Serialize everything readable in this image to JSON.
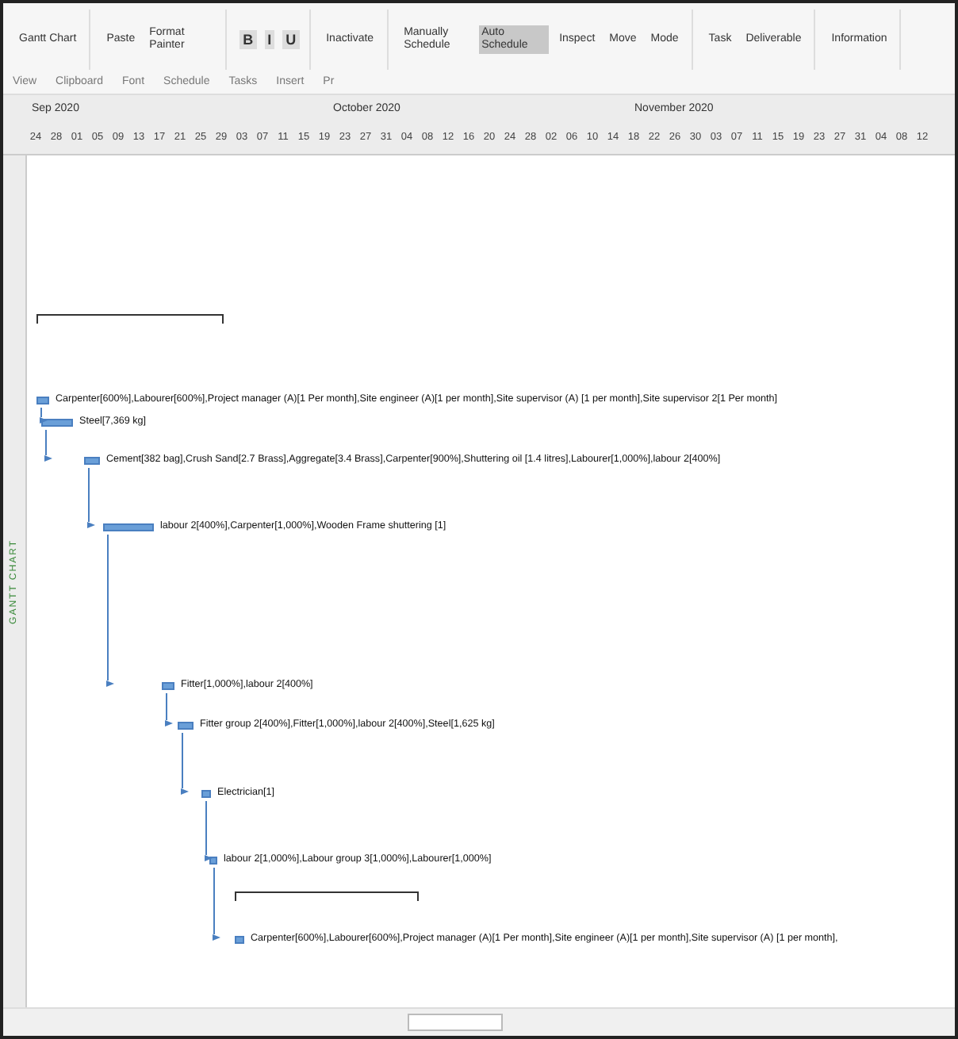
{
  "ribbon": {
    "groups": [
      {
        "label": "View",
        "commands": [
          {
            "label": "Gantt Chart",
            "kind": "big"
          }
        ]
      },
      {
        "label": "Clipboard",
        "commands": [
          {
            "label": "Paste",
            "kind": "big"
          },
          {
            "label": "Format Painter",
            "kind": "small"
          }
        ]
      },
      {
        "label": "Font",
        "commands": [
          {
            "label": "B",
            "kind": "format"
          },
          {
            "label": "I",
            "kind": "format"
          },
          {
            "label": "U",
            "kind": "format"
          }
        ]
      },
      {
        "label": "Schedule",
        "commands": [
          {
            "label": "Inactivate",
            "kind": "small"
          }
        ]
      },
      {
        "label": "Tasks",
        "commands": [
          {
            "label": "Manually Schedule",
            "kind": "toggle",
            "selected": false
          },
          {
            "label": "Auto Schedule",
            "kind": "toggle",
            "selected": true
          },
          {
            "label": "Inspect",
            "kind": "big"
          },
          {
            "label": "Move",
            "kind": "big"
          },
          {
            "label": "Mode",
            "kind": "big"
          }
        ]
      },
      {
        "label": "Insert",
        "commands": [
          {
            "label": "Task",
            "kind": "big"
          },
          {
            "label": "Deliverable",
            "kind": "small"
          }
        ]
      },
      {
        "label": "Pr",
        "commands": [
          {
            "label": "Information",
            "kind": "big"
          }
        ]
      }
    ]
  },
  "timescale": {
    "months": [
      "Sep 2020",
      "October 2020",
      "November 2020"
    ],
    "days": [
      "24",
      "28",
      "01",
      "05",
      "09",
      "13",
      "17",
      "21",
      "25",
      "29",
      "03",
      "07",
      "11",
      "15",
      "19",
      "23",
      "27",
      "31",
      "04",
      "08",
      "12",
      "16",
      "20",
      "24",
      "28",
      "02",
      "06",
      "10",
      "14",
      "18",
      "22",
      "26",
      "30",
      "03",
      "07",
      "11",
      "15",
      "19",
      "23",
      "27",
      "31",
      "04",
      "08",
      "12"
    ]
  },
  "side_label": "GANTT CHART",
  "gantt": [
    {
      "kind": "summary"
    },
    {
      "kind": "task",
      "label": "Carpenter[600%],Labourer[600%],Project manager (A)[1 Per month],Site engineer (A)[1 per month],Site supervisor (A) [1 per month],Site supervisor 2[1 Per month]"
    },
    {
      "kind": "task",
      "label": "Steel[7,369 kg]"
    },
    {
      "kind": "task",
      "label": "Cement[382 bag],Crush Sand[2.7 Brass],Aggregate[3.4 Brass],Carpenter[900%],Shuttering oil [1.4 litres],Labourer[1,000%],labour 2[400%]"
    },
    {
      "kind": "task",
      "label": "labour 2[400%],Carpenter[1,000%],Wooden Frame shuttering [1]"
    },
    {
      "kind": "task",
      "label": "Fitter[1,000%],labour 2[400%]"
    },
    {
      "kind": "task",
      "label": "Fitter group 2[400%],Fitter[1,000%],labour 2[400%],Steel[1,625 kg]"
    },
    {
      "kind": "task",
      "label": "Electrician[1]"
    },
    {
      "kind": "task",
      "label": "labour 2[1,000%],Labour group 3[1,000%],Labourer[1,000%]"
    },
    {
      "kind": "summary"
    },
    {
      "kind": "task",
      "label": "Carpenter[600%],Labourer[600%],Project manager (A)[1 Per month],Site engineer (A)[1 per month],Site supervisor (A) [1 per month],"
    }
  ]
}
